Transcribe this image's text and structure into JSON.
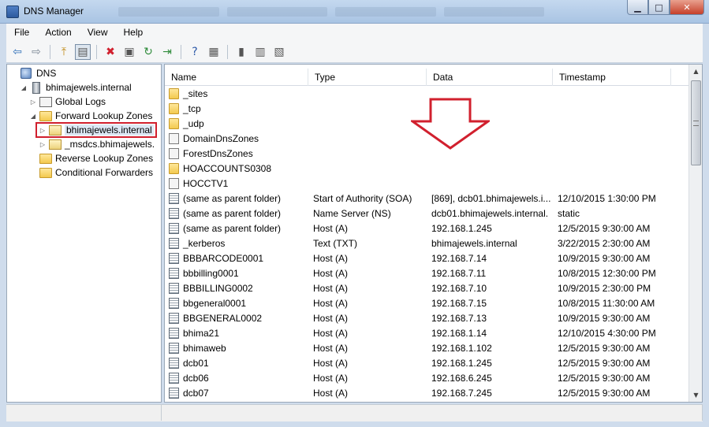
{
  "window": {
    "title": "DNS Manager"
  },
  "menu": [
    "File",
    "Action",
    "View",
    "Help"
  ],
  "toolbar": [
    {
      "icon": "back-arrow-icon",
      "glyph": "⇦"
    },
    {
      "icon": "forward-arrow-icon",
      "glyph": "⇨"
    },
    {
      "icon": "up-folder-icon",
      "glyph": "⤒"
    },
    {
      "icon": "show-hide-tree-icon",
      "glyph": "▤",
      "active": true
    },
    {
      "icon": "delete-icon",
      "glyph": "✖"
    },
    {
      "icon": "properties-icon",
      "glyph": "▣"
    },
    {
      "icon": "refresh-icon",
      "glyph": "↻"
    },
    {
      "icon": "export-list-icon",
      "glyph": "⇥"
    },
    {
      "icon": "help-icon",
      "glyph": "?"
    },
    {
      "icon": "show-action-pane-icon",
      "glyph": "▦"
    },
    {
      "icon": "new-host-icon",
      "glyph": "▮"
    },
    {
      "icon": "new-alias-icon",
      "glyph": "▥"
    },
    {
      "icon": "new-mail-exchanger-icon",
      "glyph": "▧"
    }
  ],
  "tree": [
    {
      "label": "DNS",
      "icon": "dns-icon",
      "expander": ""
    },
    {
      "label": "bhimajewels.internal",
      "icon": "server-icon",
      "expander": "◢"
    },
    {
      "label": "Global Logs",
      "icon": "log-icon",
      "expander": "▷"
    },
    {
      "label": "Forward Lookup Zones",
      "icon": "folder-icon",
      "expander": "◢"
    },
    {
      "label": "bhimajewels.internal",
      "icon": "zone-icon",
      "expander": "▷",
      "selected": true
    },
    {
      "label": "_msdcs.bhimajewels.",
      "icon": "zone-icon",
      "expander": "▷"
    },
    {
      "label": "Reverse Lookup Zones",
      "icon": "folder-icon",
      "expander": ""
    },
    {
      "label": "Conditional Forwarders",
      "icon": "folder-icon",
      "expander": ""
    }
  ],
  "columns": [
    "Name",
    "Type",
    "Data",
    "Timestamp"
  ],
  "records": [
    {
      "name": "_sites",
      "type": "",
      "data": "",
      "timestamp": "",
      "icon": "folder-icon"
    },
    {
      "name": "_tcp",
      "type": "",
      "data": "",
      "timestamp": "",
      "icon": "folder-icon"
    },
    {
      "name": "_udp",
      "type": "",
      "data": "",
      "timestamp": "",
      "icon": "folder-icon"
    },
    {
      "name": "DomainDnsZones",
      "type": "",
      "data": "",
      "timestamp": "",
      "icon": "subzone-icon"
    },
    {
      "name": "ForestDnsZones",
      "type": "",
      "data": "",
      "timestamp": "",
      "icon": "subzone-icon"
    },
    {
      "name": "HOACCOUNTS0308",
      "type": "",
      "data": "",
      "timestamp": "",
      "icon": "folder-icon"
    },
    {
      "name": "HOCCTV1",
      "type": "",
      "data": "",
      "timestamp": "",
      "icon": "subzone-icon"
    },
    {
      "name": "(same as parent folder)",
      "type": "Start of Authority (SOA)",
      "data": "[869], dcb01.bhimajewels.i...",
      "timestamp": "12/10/2015 1:30:00 PM",
      "icon": "record-icon"
    },
    {
      "name": "(same as parent folder)",
      "type": "Name Server (NS)",
      "data": "dcb01.bhimajewels.internal.",
      "timestamp": "static",
      "icon": "record-icon"
    },
    {
      "name": "(same as parent folder)",
      "type": "Host (A)",
      "data": "192.168.1.245",
      "timestamp": "12/5/2015 9:30:00 AM",
      "icon": "record-icon"
    },
    {
      "name": "_kerberos",
      "type": "Text (TXT)",
      "data": "bhimajewels.internal",
      "timestamp": "3/22/2015 2:30:00 AM",
      "icon": "record-icon"
    },
    {
      "name": "BBBARCODE0001",
      "type": "Host (A)",
      "data": "192.168.7.14",
      "timestamp": "10/9/2015 9:30:00 AM",
      "icon": "record-icon"
    },
    {
      "name": "bbbilling0001",
      "type": "Host (A)",
      "data": "192.168.7.11",
      "timestamp": "10/8/2015 12:30:00 PM",
      "icon": "record-icon"
    },
    {
      "name": "BBBILLING0002",
      "type": "Host (A)",
      "data": "192.168.7.10",
      "timestamp": "10/9/2015 2:30:00 PM",
      "icon": "record-icon"
    },
    {
      "name": "bbgeneral0001",
      "type": "Host (A)",
      "data": "192.168.7.15",
      "timestamp": "10/8/2015 11:30:00 AM",
      "icon": "record-icon"
    },
    {
      "name": "BBGENERAL0002",
      "type": "Host (A)",
      "data": "192.168.7.13",
      "timestamp": "10/9/2015 9:30:00 AM",
      "icon": "record-icon"
    },
    {
      "name": "bhima21",
      "type": "Host (A)",
      "data": "192.168.1.14",
      "timestamp": "12/10/2015 4:30:00 PM",
      "icon": "record-icon"
    },
    {
      "name": "bhimaweb",
      "type": "Host (A)",
      "data": "192.168.1.102",
      "timestamp": "12/5/2015 9:30:00 AM",
      "icon": "record-icon"
    },
    {
      "name": "dcb01",
      "type": "Host (A)",
      "data": "192.168.1.245",
      "timestamp": "12/5/2015 9:30:00 AM",
      "icon": "record-icon"
    },
    {
      "name": "dcb06",
      "type": "Host (A)",
      "data": "192.168.6.245",
      "timestamp": "12/5/2015 9:30:00 AM",
      "icon": "record-icon"
    },
    {
      "name": "dcb07",
      "type": "Host (A)",
      "data": "192.168.7.245",
      "timestamp": "12/5/2015 9:30:00 AM",
      "icon": "record-icon"
    }
  ],
  "colors": {
    "annotation": "#d1202e",
    "selection_border": "#d1202e"
  }
}
